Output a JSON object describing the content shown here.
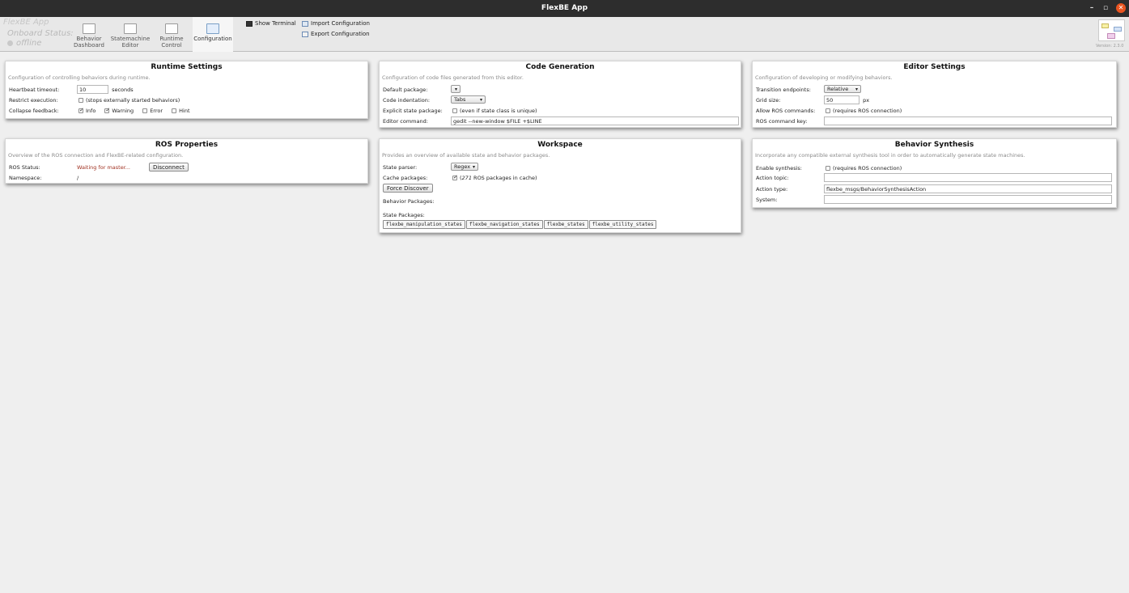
{
  "window": {
    "title": "FlexBE App"
  },
  "toolbar": {
    "app_name": "FlexBE  App",
    "onboard_label": "Onboard Status:",
    "onboard_status": "offline",
    "tabs": [
      {
        "label_line1": "Behavior",
        "label_line2": "Dashboard"
      },
      {
        "label_line1": "Statemachine",
        "label_line2": "Editor"
      },
      {
        "label_line1": "Runtime",
        "label_line2": "Control"
      },
      {
        "label_line1": "Configuration",
        "label_line2": ""
      }
    ],
    "show_terminal": "Show Terminal",
    "import_config": "Import Configuration",
    "export_config": "Export Configuration",
    "version": "Version: 2.3.0"
  },
  "runtime_settings": {
    "title": "Runtime Settings",
    "description": "Configuration of controlling behaviors during runtime.",
    "heartbeat_label": "Heartbeat timeout:",
    "heartbeat_value": "10",
    "heartbeat_unit": "seconds",
    "restrict_label": "Restrict execution:",
    "restrict_note": "(stops externally started behaviors)",
    "collapse_label": "Collapse feedback:",
    "collapse_options": [
      {
        "label": "Info",
        "checked": true
      },
      {
        "label": "Warning",
        "checked": true
      },
      {
        "label": "Error",
        "checked": false
      },
      {
        "label": "Hint",
        "checked": false
      }
    ]
  },
  "code_generation": {
    "title": "Code Generation",
    "description": "Configuration of code files generated from this editor.",
    "default_package_label": "Default package:",
    "default_package_value": "",
    "indentation_label": "Code indentation:",
    "indentation_value": "Tabs",
    "explicit_label": "Explicit state package:",
    "explicit_note": "(even if state class is unique)",
    "editor_label": "Editor command:",
    "editor_value": "gedit --new-window $FILE +$LINE"
  },
  "editor_settings": {
    "title": "Editor Settings",
    "description": "Configuration of developing or modifying behaviors.",
    "transition_label": "Transition endpoints:",
    "transition_value": "Relative",
    "grid_label": "Grid size:",
    "grid_value": "50",
    "grid_unit": "px",
    "ros_cmd_label": "Allow ROS commands:",
    "ros_cmd_note": "(requires ROS connection)",
    "ros_key_label": "ROS command key:",
    "ros_key_value": ""
  },
  "ros_properties": {
    "title": "ROS Properties",
    "description": "Overview of the ROS connection and FlexBE-related configuration.",
    "status_label": "ROS Status:",
    "status_value": "Waiting for master...",
    "disconnect_label": "Disconnect",
    "namespace_label": "Namespace:",
    "namespace_value": "/"
  },
  "workspace": {
    "title": "Workspace",
    "description": "Provides an overview of available state and behavior packages.",
    "parser_label": "State parser:",
    "parser_value": "Regex",
    "cache_label": "Cache packages:",
    "cache_count": "271",
    "cache_note": "ROS packages in cache)",
    "force_label": "Force Discover",
    "behavior_packages_label": "Behavior Packages:",
    "state_packages_label": "State Packages:",
    "state_packages": [
      "flexbe_manipulation_states",
      "flexbe_navigation_states",
      "flexbe_states",
      "flexbe_utility_states"
    ]
  },
  "behavior_synthesis": {
    "title": "Behavior Synthesis",
    "description": "Incorporate any compatible external synthesis tool in order to automatically generate state machines.",
    "enable_label": "Enable synthesis:",
    "enable_note": "(requires ROS connection)",
    "topic_label": "Action topic:",
    "topic_value": "",
    "type_label": "Action type:",
    "type_value": "flexbe_msgs/BehaviorSynthesisAction",
    "system_label": "System:",
    "system_value": ""
  }
}
